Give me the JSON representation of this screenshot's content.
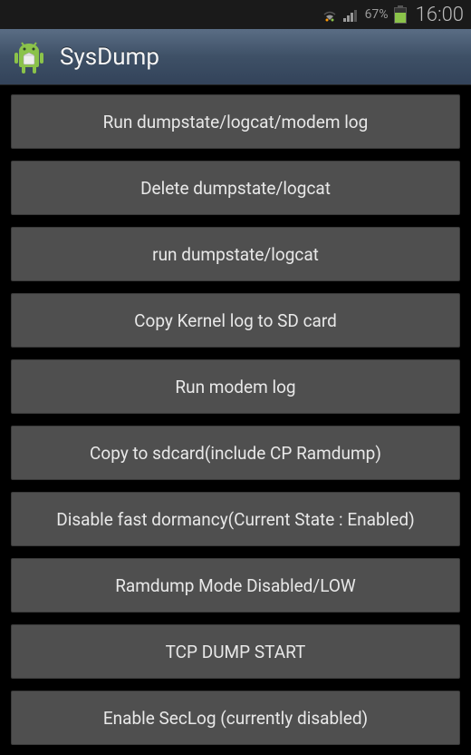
{
  "status": {
    "battery_pct": "67%",
    "time": "16:00"
  },
  "title": "SysDump",
  "buttons": [
    "Run dumpstate/logcat/modem log",
    "Delete dumpstate/logcat",
    "run dumpstate/logcat",
    "Copy Kernel log to SD card",
    "Run modem log",
    "Copy to sdcard(include CP Ramdump)",
    "Disable fast dormancy(Current State : Enabled)",
    "Ramdump Mode Disabled/LOW",
    "TCP DUMP START",
    "Enable SecLog (currently disabled)"
  ]
}
